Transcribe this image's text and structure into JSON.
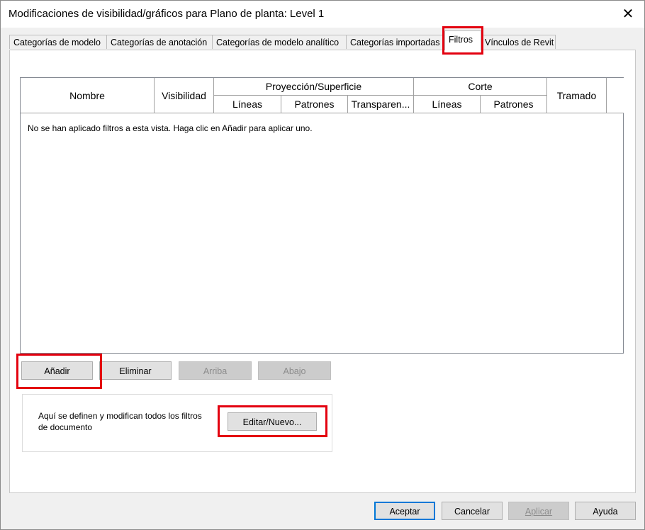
{
  "window": {
    "title": "Modificaciones de visibilidad/gráficos para Plano de planta: Level 1",
    "close_glyph": "✕"
  },
  "tabs": [
    {
      "label": "Categorías de modelo"
    },
    {
      "label": "Categorías de anotación"
    },
    {
      "label": "Categorías de modelo analítico"
    },
    {
      "label": "Categorías importadas"
    },
    {
      "label": "Filtros",
      "active": true
    },
    {
      "label": "Vínculos de Revit"
    }
  ],
  "grid": {
    "headers": {
      "nombre": "Nombre",
      "visibilidad": "Visibilidad",
      "proyeccion": "Proyección/Superficie",
      "proy_lineas": "Líneas",
      "proy_patrones": "Patrones",
      "proy_transparencia": "Transparen...",
      "corte": "Corte",
      "corte_lineas": "Líneas",
      "corte_patrones": "Patrones",
      "tramado": "Tramado"
    },
    "empty_message": "No se han aplicado filtros a esta vista. Haga clic en Añadir para aplicar uno."
  },
  "row_buttons": {
    "add": "Añadir",
    "remove": "Eliminar",
    "up": "Arriba",
    "down": "Abajo"
  },
  "filters_group": {
    "description": "Aquí se definen y modifican todos los filtros de documento",
    "edit_button": "Editar/Nuevo..."
  },
  "dialog_buttons": {
    "ok": "Aceptar",
    "cancel": "Cancelar",
    "apply": "Aplicar",
    "help": "Ayuda"
  },
  "highlight_color": "#e3000f",
  "focus_color": "#0078d7"
}
